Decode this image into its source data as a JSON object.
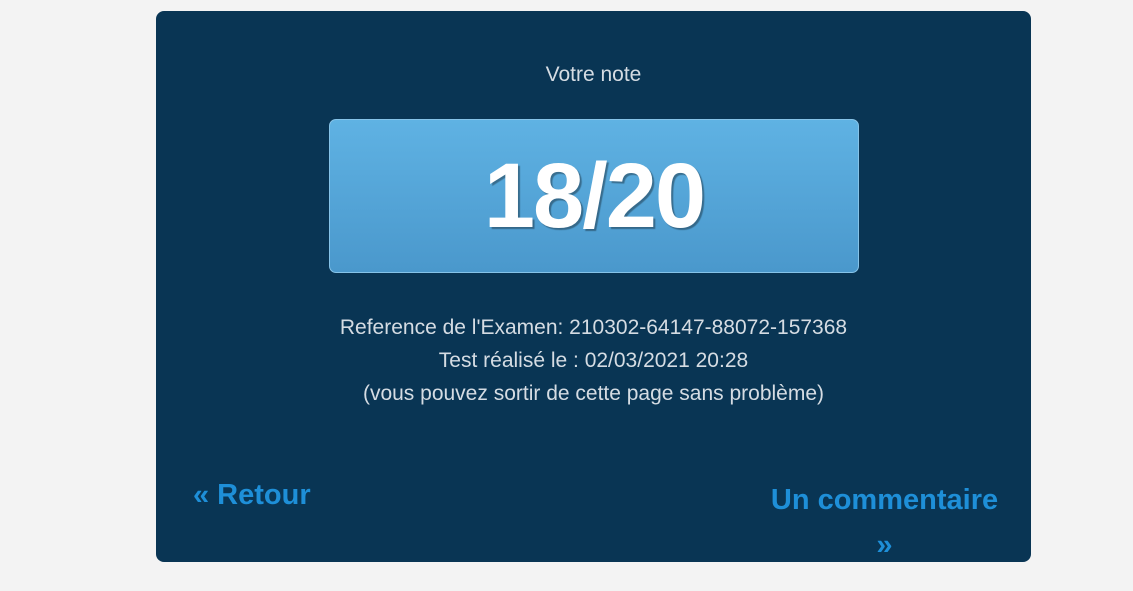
{
  "result": {
    "title": "Votre note",
    "score": "18/20"
  },
  "details": {
    "reference": "Reference de l'Examen: 210302-64147-88072-157368",
    "date": "Test réalisé le : 02/03/2021 20:28",
    "note": "(vous pouvez sortir de cette page sans problème)"
  },
  "navigation": {
    "back_label": "« Retour",
    "comment_label": "Un commentaire »"
  },
  "colors": {
    "page_background": "#f3f3f3",
    "card_background": "#093554",
    "score_box": "#56a6d9",
    "link": "#1e8fd8",
    "text": "#d5dce3"
  }
}
